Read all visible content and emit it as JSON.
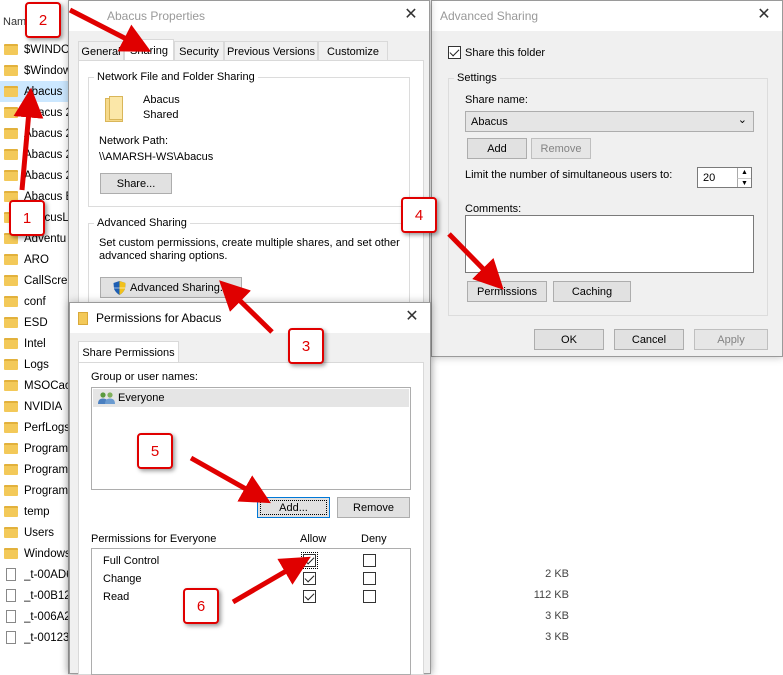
{
  "explorer": {
    "column_header": "Nam",
    "rows": [
      {
        "name": "$WINDO",
        "type": "folder",
        "size": ""
      },
      {
        "name": "$Window",
        "type": "folder",
        "size": ""
      },
      {
        "name": "Abacus",
        "type": "folder",
        "size": "",
        "selected": true
      },
      {
        "name": "Abacus 2",
        "type": "folder",
        "size": ""
      },
      {
        "name": "Abacus 2",
        "type": "folder",
        "size": ""
      },
      {
        "name": "Abacus 2",
        "type": "folder",
        "size": ""
      },
      {
        "name": "Abacus 2",
        "type": "folder",
        "size": ""
      },
      {
        "name": "Abacus B",
        "type": "folder",
        "size": ""
      },
      {
        "name": "AbacusL",
        "type": "folder",
        "size": ""
      },
      {
        "name": "Adventu",
        "type": "folder",
        "size": ""
      },
      {
        "name": "ARO",
        "type": "folder",
        "size": ""
      },
      {
        "name": "CallScre",
        "type": "folder",
        "size": ""
      },
      {
        "name": "conf",
        "type": "folder",
        "size": ""
      },
      {
        "name": "ESD",
        "type": "folder",
        "size": ""
      },
      {
        "name": "Intel",
        "type": "folder",
        "size": ""
      },
      {
        "name": "Logs",
        "type": "folder",
        "size": ""
      },
      {
        "name": "MSOCac",
        "type": "folder",
        "size": ""
      },
      {
        "name": "NVIDIA",
        "type": "folder",
        "size": ""
      },
      {
        "name": "PerfLogs",
        "type": "folder",
        "size": ""
      },
      {
        "name": "Program",
        "type": "folder",
        "size": ""
      },
      {
        "name": "Program",
        "type": "folder",
        "size": ""
      },
      {
        "name": "Program",
        "type": "folder",
        "size": ""
      },
      {
        "name": "temp",
        "type": "folder",
        "size": ""
      },
      {
        "name": "Users",
        "type": "folder",
        "size": ""
      },
      {
        "name": "Windows",
        "type": "folder",
        "size": ""
      },
      {
        "name": "_t-00AD6",
        "type": "file",
        "size": "2 KB"
      },
      {
        "name": "_t-00B12",
        "type": "file",
        "size": "112 KB"
      },
      {
        "name": "_t-006A2",
        "type": "file",
        "size": "3 KB"
      },
      {
        "name": "_t-00123.",
        "type": "file",
        "size": "3 KB"
      }
    ]
  },
  "properties": {
    "title": "Abacus Properties",
    "tabs": [
      "General",
      "Sharing",
      "Security",
      "Previous Versions",
      "Customize"
    ],
    "active_tab": "Sharing",
    "network_group_title": "Network File and Folder Sharing",
    "folder_name": "Abacus",
    "folder_status": "Shared",
    "network_path_label": "Network Path:",
    "network_path": "\\\\AMARSH-WS\\Abacus",
    "share_button": "Share...",
    "advanced_group_title": "Advanced Sharing",
    "advanced_desc_line1": "Set custom permissions, create multiple shares, and set other",
    "advanced_desc_line2": "advanced sharing options.",
    "advanced_button": "Advanced Sharing..."
  },
  "advanced_sharing": {
    "title": "Advanced Sharing",
    "share_checkbox_label": "Share this folder",
    "share_checked": true,
    "settings_title": "Settings",
    "share_name_label": "Share name:",
    "share_name_value": "Abacus",
    "add_button": "Add",
    "remove_button": "Remove",
    "limit_label": "Limit the number of simultaneous users to:",
    "limit_value": "20",
    "comments_label": "Comments:",
    "permissions_button": "Permissions",
    "caching_button": "Caching",
    "ok_button": "OK",
    "cancel_button": "Cancel",
    "apply_button": "Apply"
  },
  "permissions": {
    "title": "Permissions for Abacus",
    "tab": "Share Permissions",
    "group_label": "Group or user names:",
    "users": [
      "Everyone"
    ],
    "add_button": "Add...",
    "remove_button": "Remove",
    "perm_header": "Permissions for Everyone",
    "allow_header": "Allow",
    "deny_header": "Deny",
    "rows": [
      {
        "name": "Full Control",
        "allow": true,
        "deny": false
      },
      {
        "name": "Change",
        "allow": true,
        "deny": false
      },
      {
        "name": "Read",
        "allow": true,
        "deny": false
      }
    ]
  },
  "annotations": [
    "1",
    "2",
    "3",
    "4",
    "5",
    "6"
  ],
  "colors": {
    "annotation_red": "#e00000",
    "selection": "#cce8ff",
    "focus_blue": "#0078d7",
    "folder_yellow": "#f3c959"
  }
}
